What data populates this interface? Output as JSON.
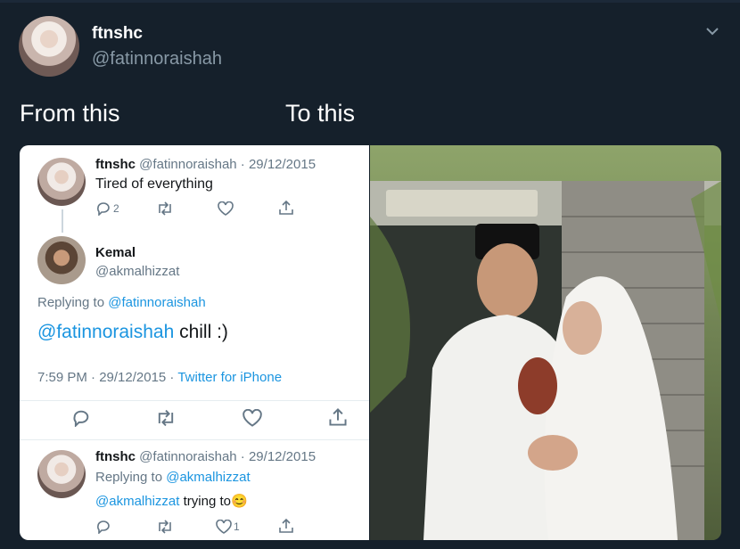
{
  "tweet": {
    "author_name": "ftnshc",
    "author_handle": "@fatinnoraishah"
  },
  "captions": {
    "left": "From this",
    "right": "To this"
  },
  "screenshot": {
    "tweet1": {
      "name": "ftnshc",
      "handle_date": "@fatinnoraishah · 29/12/2015",
      "text": "Tired of everything",
      "reply_count": "2"
    },
    "reply": {
      "name": "Kemal",
      "handle": "@akmalhizzat",
      "replying_prefix": "Replying to ",
      "replying_handle": "@fatinnoraishah",
      "text_mention": "@fatinnoraishah",
      "text_rest": " chill :)",
      "timestamp": "7:59 PM · 29/12/2015 · ",
      "source": "Twitter for iPhone"
    },
    "tweet3": {
      "name": "ftnshc",
      "handle_date": "@fatinnoraishah · 29/12/2015",
      "replying_prefix": "Replying to ",
      "replying_handle": "@akmalhizzat",
      "text_mention": "@akmalhizzat",
      "text_rest": " trying to",
      "emoji": "😊",
      "like_count": "1"
    }
  },
  "icons": [
    "chevron-down-icon",
    "reply-icon",
    "retweet-icon",
    "like-icon",
    "share-icon"
  ],
  "colors": {
    "background": "#15202b",
    "handle": "#8899a6",
    "link": "#1b95e0",
    "muted": "#657786"
  }
}
